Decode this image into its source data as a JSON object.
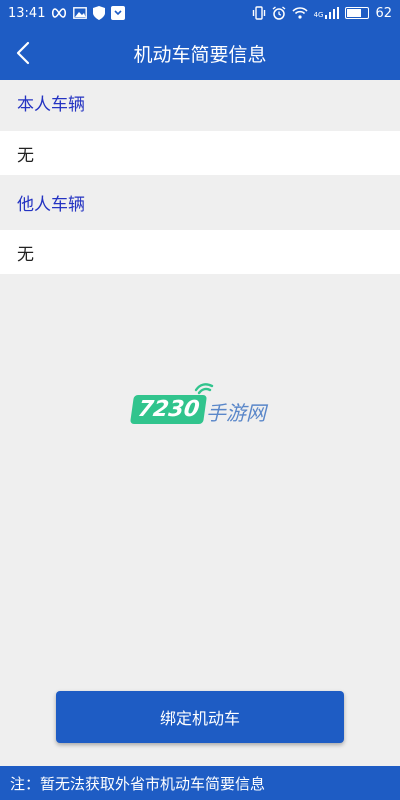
{
  "status_bar": {
    "time": "13:41",
    "network": "4G",
    "battery": "62",
    "battery_level": 0.62
  },
  "header": {
    "title": "机动车简要信息",
    "back_icon": "chevron-left-icon"
  },
  "sections": [
    {
      "header": "本人车辆",
      "value": "无"
    },
    {
      "header": "他人车辆",
      "value": "无"
    }
  ],
  "watermark": {
    "number": "7230",
    "text": "手游网"
  },
  "bind_button": {
    "label": "绑定机动车"
  },
  "footer": {
    "note": "注：暂无法获取外省市机动车简要信息"
  },
  "colors": {
    "primary": "#1e5cc4",
    "section_text": "#2433c2",
    "background": "#efefef",
    "watermark_green": "#31c48d"
  }
}
